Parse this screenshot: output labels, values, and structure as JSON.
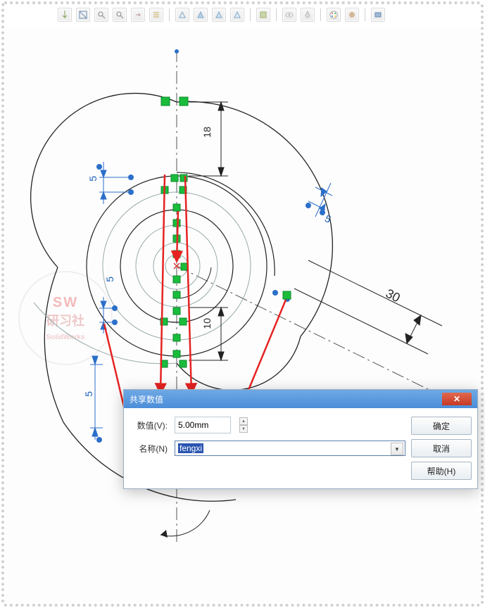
{
  "toolbar_icons": [
    "view",
    "section",
    "zoom-all",
    "zoom-area",
    "pan",
    "list",
    "display1",
    "display2",
    "display3",
    "display4",
    "shaded",
    "eye",
    "drop",
    "palette",
    "appearance",
    "render"
  ],
  "dimensions": {
    "d18": "18",
    "d5a": "5",
    "d5b": "5",
    "d5c": "5",
    "d5d": "5",
    "d10": "10",
    "d30": "30"
  },
  "watermark": {
    "l1": "SW",
    "l2": "研习社",
    "l3": "SolidWorks"
  },
  "dialog": {
    "title": "共享数值",
    "labels": {
      "value": "数值(V):",
      "name": "名称(N)"
    },
    "value": "5.00mm",
    "name": "fengxi",
    "buttons": {
      "ok": "确定",
      "cancel": "取消",
      "help": "帮助(H)"
    }
  }
}
